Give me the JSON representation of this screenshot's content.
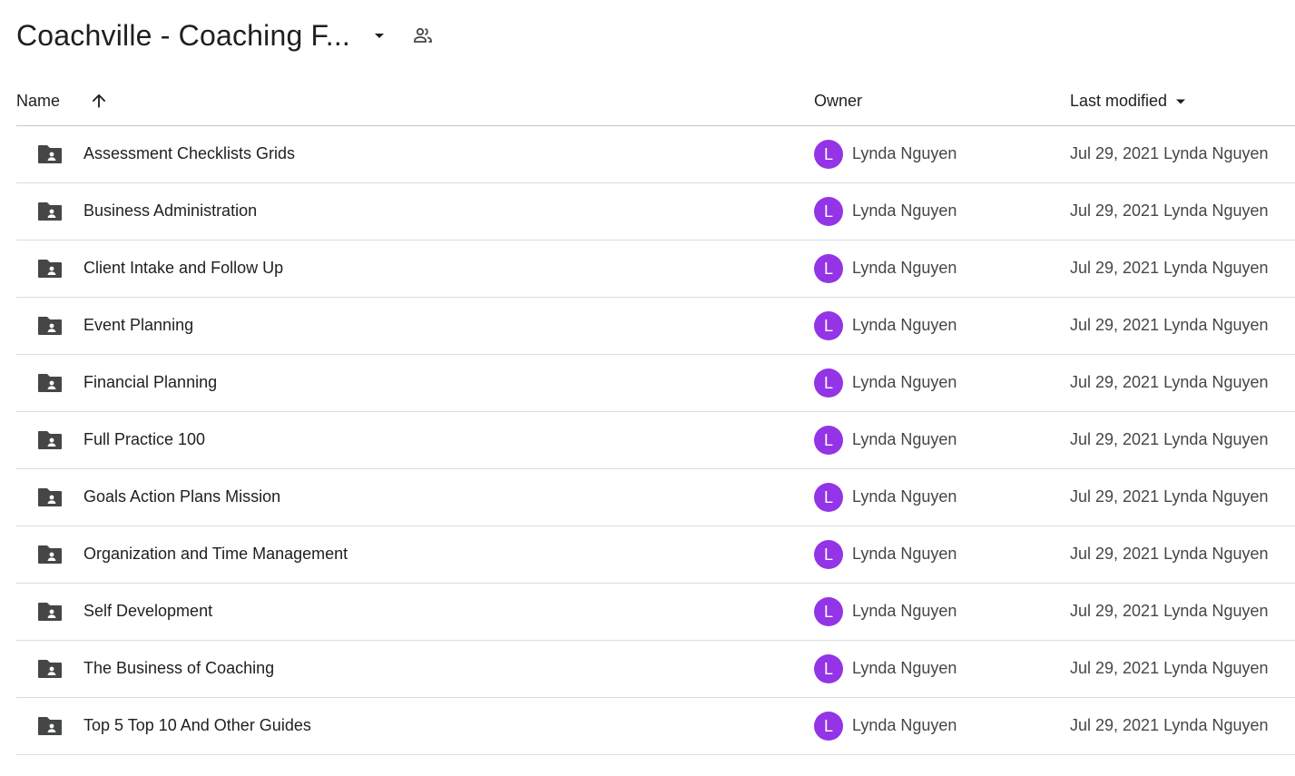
{
  "header": {
    "title": "Coachville - Coaching F...",
    "title_dropdown_icon": "arrow-drop-down-icon",
    "shared_icon": "people-icon"
  },
  "columns": {
    "name": "Name",
    "sort_icon": "arrow-upward-icon",
    "owner": "Owner",
    "last_modified": "Last modified",
    "last_modified_icon": "arrow-drop-down-icon"
  },
  "colors": {
    "avatar": "#9334e6",
    "folder_icon": "#444746",
    "divider": "#dadce0"
  },
  "rows": [
    {
      "name": "Assessment Checklists Grids",
      "owner_initial": "L",
      "owner": "Lynda Nguyen",
      "modified": "Jul 29, 2021 Lynda Nguyen"
    },
    {
      "name": "Business Administration",
      "owner_initial": "L",
      "owner": "Lynda Nguyen",
      "modified": "Jul 29, 2021 Lynda Nguyen"
    },
    {
      "name": "Client Intake and Follow Up",
      "owner_initial": "L",
      "owner": "Lynda Nguyen",
      "modified": "Jul 29, 2021 Lynda Nguyen"
    },
    {
      "name": "Event Planning",
      "owner_initial": "L",
      "owner": "Lynda Nguyen",
      "modified": "Jul 29, 2021 Lynda Nguyen"
    },
    {
      "name": "Financial Planning",
      "owner_initial": "L",
      "owner": "Lynda Nguyen",
      "modified": "Jul 29, 2021 Lynda Nguyen"
    },
    {
      "name": "Full Practice 100",
      "owner_initial": "L",
      "owner": "Lynda Nguyen",
      "modified": "Jul 29, 2021 Lynda Nguyen"
    },
    {
      "name": "Goals Action Plans Mission",
      "owner_initial": "L",
      "owner": "Lynda Nguyen",
      "modified": "Jul 29, 2021 Lynda Nguyen"
    },
    {
      "name": "Organization and Time Management",
      "owner_initial": "L",
      "owner": "Lynda Nguyen",
      "modified": "Jul 29, 2021 Lynda Nguyen"
    },
    {
      "name": "Self Development",
      "owner_initial": "L",
      "owner": "Lynda Nguyen",
      "modified": "Jul 29, 2021 Lynda Nguyen"
    },
    {
      "name": "The Business of Coaching",
      "owner_initial": "L",
      "owner": "Lynda Nguyen",
      "modified": "Jul 29, 2021 Lynda Nguyen"
    },
    {
      "name": "Top 5 Top 10 And Other Guides",
      "owner_initial": "L",
      "owner": "Lynda Nguyen",
      "modified": "Jul 29, 2021 Lynda Nguyen"
    }
  ]
}
